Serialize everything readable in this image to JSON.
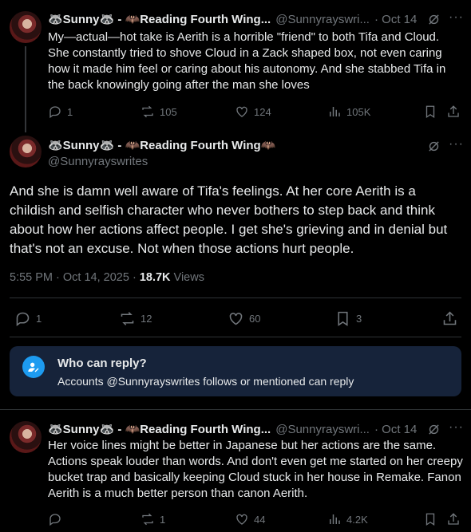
{
  "tweets": {
    "first": {
      "name": "🦝Sunny🦝 - 🦇Reading Fourth Wing...",
      "handle": "@Sunnyrayswri...",
      "date": "· Oct 14",
      "text": "My—actual—hot take is Aerith is a horrible \"friend\" to both Tifa and Cloud. She constantly tried to shove Cloud in a Zack shaped box, not even caring how it made him feel or caring about his autonomy. And she stabbed Tifa in the back knowingly going after the man she loves",
      "replies": "1",
      "reposts": "105",
      "likes": "124",
      "views": "105K"
    },
    "main": {
      "name": "🦝Sunny🦝 - 🦇Reading Fourth Wing🦇",
      "handle": "@Sunnyrayswrites",
      "text": "And she is damn well aware of Tifa's feelings. At her core Aerith is a childish and selfish character who never bothers to step back and think about how her actions affect people. I get she's grieving and in denial but that's not an excuse. Not when those actions hurt people.",
      "timestamp": "5:55 PM · Oct 14, 2025 · ",
      "views_count": "18.7K",
      "views_label": " Views",
      "replies": "1",
      "reposts": "12",
      "likes": "60",
      "bookmarks": "3"
    },
    "reply": {
      "name": "🦝Sunny🦝 - 🦇Reading Fourth Wing...",
      "handle": "@Sunnyrayswri...",
      "date": "· Oct 14",
      "text": "Her voice lines might be better in Japanese but her actions are the same. Actions speak louder than words. And don't even get me started on her creepy bucket trap and basically keeping Cloud stuck in her house in Remake. Fanon Aerith is a much better person than canon Aerith.",
      "replies": "",
      "reposts": "1",
      "likes": "44",
      "views": "4.2K"
    }
  },
  "reply_notice": {
    "title": "Who can reply?",
    "text": "Accounts @Sunnyrayswrites follows or mentioned can reply"
  },
  "colors": {
    "background": "#000000",
    "text": "#e7e9ea",
    "muted": "#71767b",
    "accent": "#1d9bf0",
    "notice_bg": "#16233a"
  }
}
